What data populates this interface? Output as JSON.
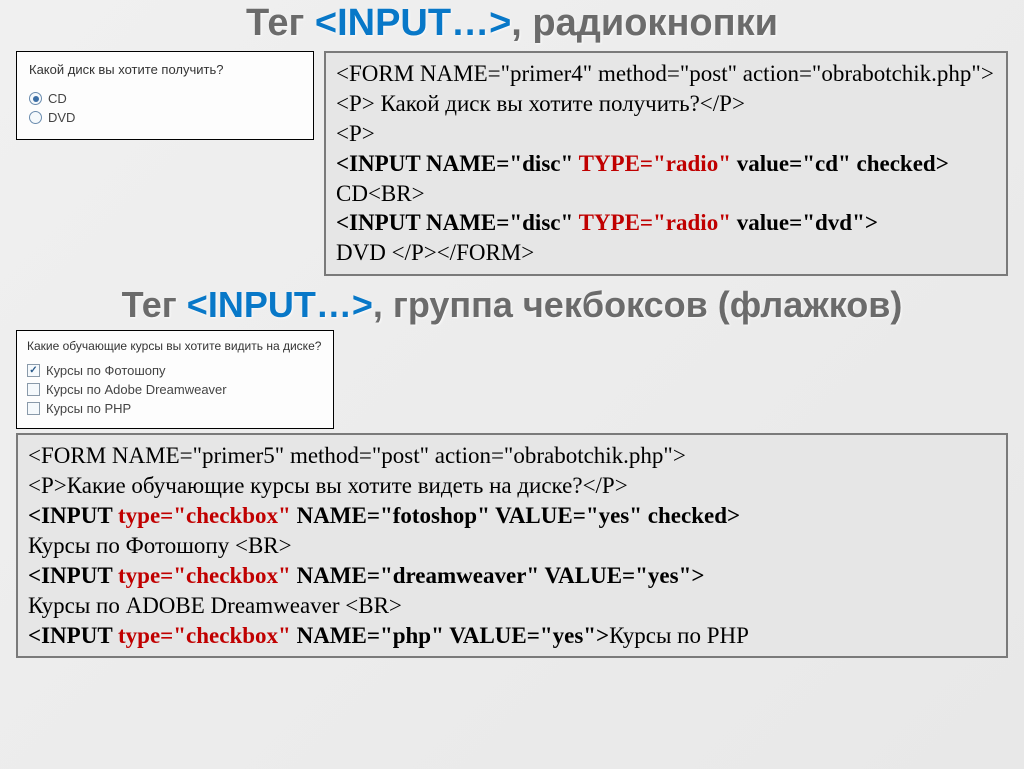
{
  "heading1": {
    "prefix": "Тег ",
    "tag": "<INPUT…>",
    "suffix": ", радиокнопки"
  },
  "heading2": {
    "prefix": "Тег ",
    "tag": "<INPUT…>",
    "suffix": ", группа чекбоксов (флажков)"
  },
  "radio_example": {
    "question": "Какой диск вы хотите получить?",
    "opt1": "CD",
    "opt2": "DVD"
  },
  "radio_code": {
    "l1": "<FORM NAME=\"primer4\" method=\"post\" action=\"obrabotchik.php\">",
    "l2a": "<P> Какой диск вы хотите получить?</P>",
    "l3": "<P>",
    "l4_pre": "<INPUT NAME=\"disc\" ",
    "l4_kw": "TYPE=\"radio\"",
    "l4_post": " value=\"cd\" checked>",
    "l5": "CD<BR>",
    "l6_pre": "<INPUT NAME=\"disc\" ",
    "l6_kw": "TYPE=\"radio\"",
    "l6_post": " value=\"dvd\">",
    "l7": "DVD </P></FORM>"
  },
  "check_example": {
    "question": "Какие обучающие курсы вы хотите видить на диске?",
    "opt1": "Курсы по Фотошопу",
    "opt2": "Курсы по Adobe Dreamweaver",
    "opt3": "Курсы по PHP"
  },
  "check_code": {
    "l1": "<FORM NAME=\"primer5\" method=\"post\" action=\"obrabotchik.php\">",
    "l2": "<P>Какие обучающие курсы вы хотите видеть на диске?</P>",
    "l3_pre": "<INPUT ",
    "l3_kw": "type=\"checkbox\"",
    "l3_post": " NAME=\"fotoshop\" VALUE=\"yes\" checked>",
    "l4": "Курсы по Фотошопу <BR>",
    "l5_pre": "<INPUT ",
    "l5_kw": "type=\"checkbox\"",
    "l5_post": " NAME=\"dreamweaver\" VALUE=\"yes\">",
    "l6": "Курсы по ADOBE Dreamweaver <BR>",
    "l7_pre": "<INPUT ",
    "l7_kw": "type=\"checkbox\"",
    "l7_post": " NAME=\"php\" VALUE=\"yes\">",
    "l7_tail": "Курсы по PHP"
  }
}
